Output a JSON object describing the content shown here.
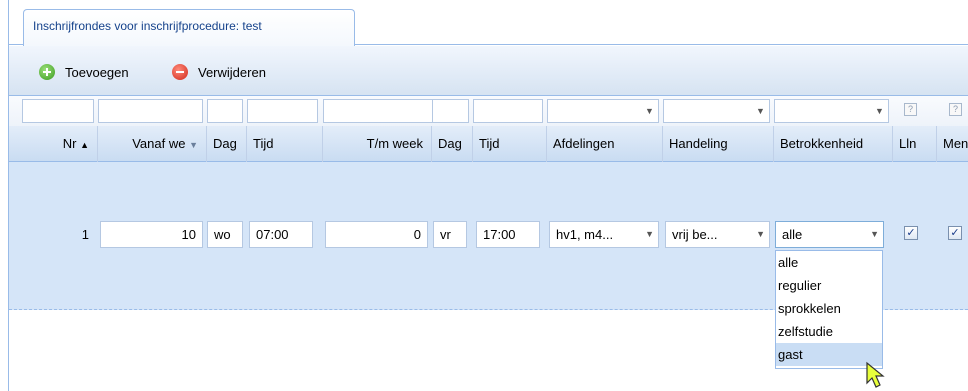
{
  "tab": {
    "title": "Inschrijfrondes voor inschrijfprocedure: test"
  },
  "toolbar": {
    "add_label": "Toevoegen",
    "remove_label": "Verwijderen"
  },
  "columns": {
    "nr": "Nr",
    "vanaf_week": "Vanaf we",
    "dag1": "Dag",
    "tijd1": "Tijd",
    "tm_week": "T/m week",
    "dag2": "Dag",
    "tijd2": "Tijd",
    "afdelingen": "Afdelingen",
    "handeling": "Handeling",
    "betrokkenheid": "Betrokkenheid",
    "lln": "Lln",
    "men": "Men"
  },
  "sort": {
    "nr_icon": "sort-asc-icon",
    "vanaf_icon": "sort-desc-icon"
  },
  "filter": {
    "help_lln": "?",
    "help_men": "?"
  },
  "rows": [
    {
      "nr": "1",
      "vanaf_week": "10",
      "dag1": "wo",
      "tijd1": "07:00",
      "tm_week": "0",
      "dag2": "vr",
      "tijd2": "17:00",
      "afdelingen": "hv1, m4...",
      "handeling": "vrij be...",
      "betrokkenheid": "alle",
      "lln_checked": "✓",
      "men_checked": "✓"
    }
  ],
  "dropdown": {
    "options": [
      "alle",
      "regulier",
      "sprokkelen",
      "zelfstudie",
      "gast"
    ],
    "hovered": "gast"
  },
  "colors": {
    "accent": "#99bbe8",
    "row_selected": "#d5e5f8",
    "header": "#c9dcf2"
  }
}
